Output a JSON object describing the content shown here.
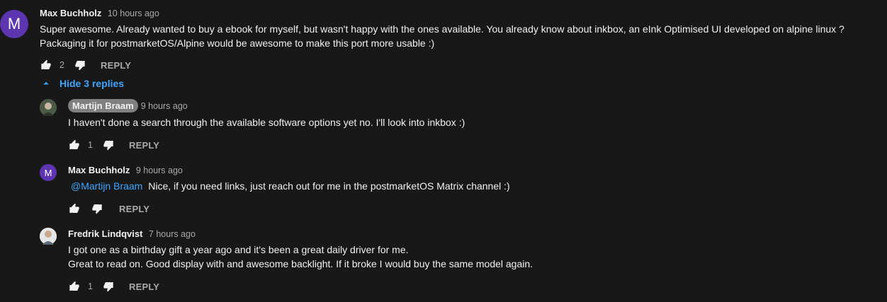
{
  "comments": [
    {
      "avatar_letter": "M",
      "author": "Max Buchholz",
      "time": "10 hours ago",
      "text_line1": "Super awesome. Already wanted to buy a ebook for myself, but wasn't happy with the ones available. You already know about inkbox, an eInk Optimised UI developed on alpine linux ?",
      "text_line2": "Packaging it for postmarketOS/Alpine would be awesome to make this port more usable :)",
      "likes": "2",
      "reply_label": "REPLY"
    }
  ],
  "hide_replies_label": "Hide 3 replies",
  "replies": [
    {
      "author": "Martijn Braam",
      "time": "9 hours ago",
      "text": "I haven't done a search through the available software options yet no. I'll look into inkbox :)",
      "likes": "1",
      "reply_label": "REPLY"
    },
    {
      "avatar_letter": "M",
      "author": "Max Buchholz",
      "time": "9 hours ago",
      "mention": "@Martijn Braam",
      "text": "Nice, if you need links, just reach out for me in the postmarketOS Matrix channel :)",
      "likes": "",
      "reply_label": "REPLY"
    },
    {
      "author": "Fredrik Lindqvist",
      "time": "7 hours ago",
      "text_line1": "I got one as a birthday gift a year ago and it's been a great daily driver for me.",
      "text_line2": "Great to read on. Good display with and awesome backlight. If it broke I would buy the same model again.",
      "likes": "1",
      "reply_label": "REPLY"
    }
  ],
  "colors": {
    "background": "#181818",
    "text": "#f1f1f1",
    "secondary": "#aaaaaa",
    "link": "#3ea6ff",
    "avatar_purple": "#5e35b1"
  }
}
